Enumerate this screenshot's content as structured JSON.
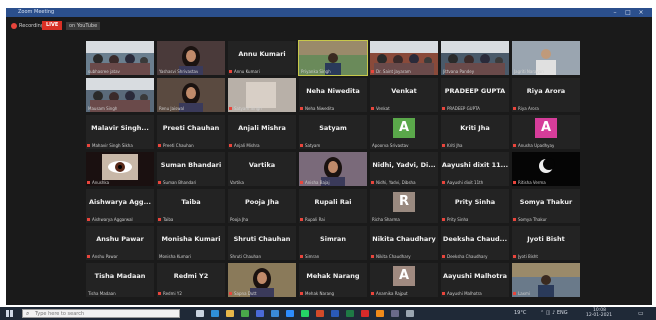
{
  "window": {
    "title": "Zoom Meeting"
  },
  "recording": {
    "label": "Recording",
    "live": "LIVE",
    "on_label": "on YouTube"
  },
  "tiles": [
    {
      "name": "",
      "cap": "subhasree jatav",
      "mic": false,
      "bg": "#6b7f8f",
      "video": "class"
    },
    {
      "name": "",
      "cap": "Yashasvi Shrivastav",
      "mic": false,
      "bg": "#4a3a3a",
      "video": "person-f"
    },
    {
      "name": "Annu Kumari",
      "cap": "Annu Kumari",
      "mic": true
    },
    {
      "name": "",
      "cap": "Priyanka Singh",
      "mic": false,
      "bg": "#6a8a5a",
      "video": "room",
      "active": true
    },
    {
      "name": "",
      "cap": "Dr. Saint Jayaram",
      "mic": true,
      "bg": "#8a4a3a",
      "video": "class"
    },
    {
      "name": "",
      "cap": "Jittvana Pandey",
      "mic": false,
      "bg": "#4a5a6a",
      "video": "class"
    },
    {
      "name": "",
      "cap": "Jagriti Narayan",
      "mic": false,
      "bg": "#9aa5b0",
      "video": "person-m"
    },
    {
      "name": "",
      "cap": "Mausam Singh",
      "mic": false,
      "bg": "#5a6a7a",
      "video": "class"
    },
    {
      "name": "",
      "cap": "Renu Jaiswal",
      "mic": false,
      "bg": "#5a4a40",
      "video": "person-f"
    },
    {
      "name": "",
      "cap": "Satyam Singh",
      "mic": true,
      "bg": "#b8b0a8",
      "video": "blur"
    },
    {
      "name": "Neha Niwedita",
      "cap": "Neha Niwedita",
      "mic": true
    },
    {
      "name": "Venkat",
      "cap": "Venkat",
      "mic": true
    },
    {
      "name": "PRADEEP GUPTA",
      "cap": "PRADEEP GUPTA",
      "mic": true
    },
    {
      "name": "Riya Arora",
      "cap": "Riya Arora",
      "mic": true
    },
    {
      "name": "Malavir Singh...",
      "cap": "Mahavir Singh Sikha",
      "mic": true
    },
    {
      "name": "Preeti Chauhan",
      "cap": "Preeti Chauhan",
      "mic": true
    },
    {
      "name": "Anjali Mishra",
      "cap": "Anjali Mishra",
      "mic": true
    },
    {
      "name": "Satyam",
      "cap": "Satyam",
      "mic": true
    },
    {
      "name": "",
      "cap": "Apoorva Srivastav",
      "mic": false,
      "avatar": "A",
      "avcolor": "#5aa84a"
    },
    {
      "name": "Kriti Jha",
      "cap": "Kriti Jha",
      "mic": true
    },
    {
      "name": "",
      "cap": "Anusha Upadhyay",
      "mic": true,
      "avatar": "A",
      "avcolor": "#d63d9a"
    },
    {
      "name": "",
      "cap": "Anushka",
      "mic": true,
      "bg": "#3a2a2a",
      "video": "eye"
    },
    {
      "name": "Suman Bhandari",
      "cap": "Suman Bhandari",
      "mic": true
    },
    {
      "name": "Vartika",
      "cap": "Vartika",
      "mic": false
    },
    {
      "name": "",
      "cap": "Anisha Bajaj",
      "mic": true,
      "bg": "#7a6a7a",
      "video": "person-f"
    },
    {
      "name": "Nidhi, Yadvi, Di...",
      "cap": "Nidhi, Yadvi, Dibsha",
      "mic": true
    },
    {
      "name": "Aayushi dixit 11...",
      "cap": "Aayushi dixit 11th",
      "mic": true
    },
    {
      "name": "",
      "cap": "Ritisha Verma",
      "mic": true,
      "bg": "#0a0a0a",
      "video": "moon"
    },
    {
      "name": "Aishwarya Agg...",
      "cap": "Aishwarya Aggarwal",
      "mic": true
    },
    {
      "name": "Taiba",
      "cap": "Taiba",
      "mic": true
    },
    {
      "name": "Pooja Jha",
      "cap": "Pooja Jha",
      "mic": false
    },
    {
      "name": "Rupali Rai",
      "cap": "Rupali Rai",
      "mic": true
    },
    {
      "name": "",
      "cap": "Richa Sharma",
      "mic": false,
      "avatar": "R",
      "avcolor": "#9a8a80"
    },
    {
      "name": "Prity Sinha",
      "cap": "Prity Sinha",
      "mic": true
    },
    {
      "name": "Somya Thakur",
      "cap": "Somya Thakur",
      "mic": true
    },
    {
      "name": "Anshu Pawar",
      "cap": "Anshu Pawar",
      "mic": true
    },
    {
      "name": "Monisha Kumari",
      "cap": "Monisha Kumari",
      "mic": false
    },
    {
      "name": "Shruti Chauhan",
      "cap": "Shruti Chauhan",
      "mic": false
    },
    {
      "name": "Simran",
      "cap": "Simran",
      "mic": true
    },
    {
      "name": "Nikita Chaudhary",
      "cap": "Nikita Chaudhary",
      "mic": true
    },
    {
      "name": "Deeksha Chaud...",
      "cap": "Deeksha Chaudhary",
      "mic": true
    },
    {
      "name": "Jyoti Bisht",
      "cap": "Jyoti Bisht",
      "mic": true
    },
    {
      "name": "Tisha Madaan",
      "cap": "Tisha Madaan",
      "mic": false
    },
    {
      "name": "Redmi Y2",
      "cap": "Redmi Y2",
      "mic": true
    },
    {
      "name": "",
      "cap": "Sapna Dutt",
      "mic": true,
      "bg": "#8a7a5a",
      "video": "person-f"
    },
    {
      "name": "Mehak Narang",
      "cap": "Mehak Narang",
      "mic": true
    },
    {
      "name": "",
      "cap": "Anamika Rajput",
      "mic": true,
      "avatar": "A",
      "avcolor": "#a08a80"
    },
    {
      "name": "Aayushi Malhotra",
      "cap": "Aayushi Malhotra",
      "mic": true
    },
    {
      "name": "",
      "cap": "Laxmi",
      "mic": true,
      "bg": "#6a7a8a",
      "video": "room"
    }
  ],
  "taskbar": {
    "search_placeholder": "Type here to search",
    "weather": "19°C",
    "clock_time": "10:08",
    "clock_date": "12-01-2021",
    "apps": [
      {
        "icon": "task-view-icon",
        "color": "#c9d3e0"
      },
      {
        "icon": "edge-icon",
        "color": "#2f8fd8"
      },
      {
        "icon": "file-explorer-icon",
        "color": "#e8b84a"
      },
      {
        "icon": "chrome-icon",
        "color": "#4aa84a"
      },
      {
        "icon": "store-icon",
        "color": "#4a6ad8"
      },
      {
        "icon": "mail-icon",
        "color": "#3a8ad8"
      },
      {
        "icon": "zoom-icon",
        "color": "#2d8cff"
      },
      {
        "icon": "whatsapp-icon",
        "color": "#25d366"
      },
      {
        "icon": "powerpoint-icon",
        "color": "#d04a2a"
      },
      {
        "icon": "word-icon",
        "color": "#2a5ab8"
      },
      {
        "icon": "excel-icon",
        "color": "#1e7a45"
      },
      {
        "icon": "acrobat-icon",
        "color": "#d82a2a"
      },
      {
        "icon": "vlc-icon",
        "color": "#f08a1a"
      },
      {
        "icon": "camera-icon",
        "color": "#6a6a8a"
      },
      {
        "icon": "settings-icon",
        "color": "#9aa5b0"
      }
    ]
  }
}
